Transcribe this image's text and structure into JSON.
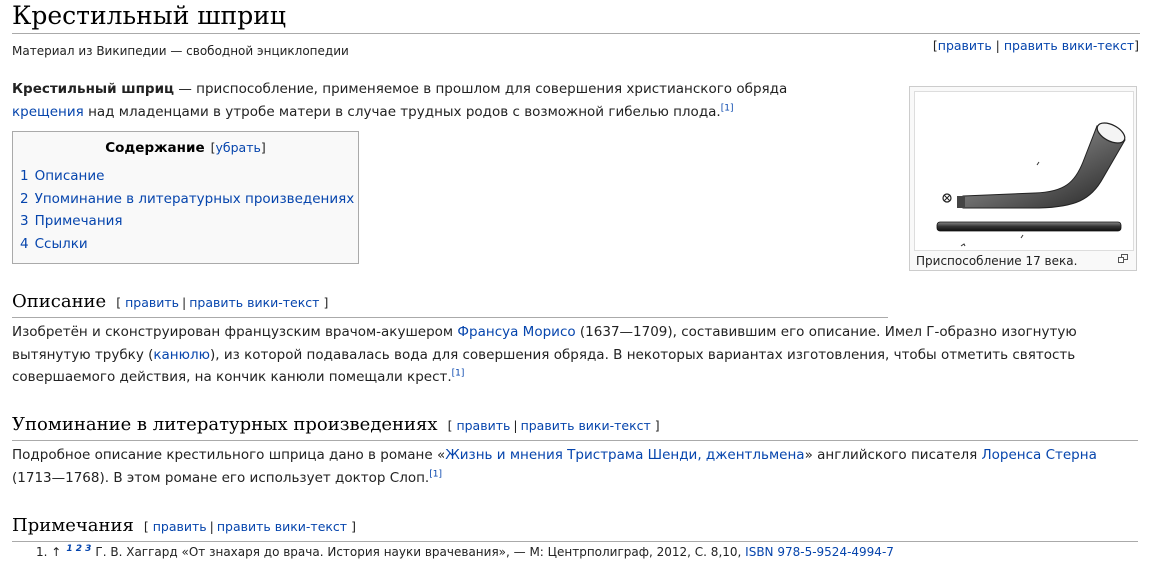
{
  "article": {
    "title": "Крестильный шприц",
    "site_sub": "Материал из Википедии — свободной энциклопедии",
    "edit_label": "править",
    "edit_wiki_label": "править вики-текст",
    "sep": "|",
    "lb": "[",
    "rb": "]"
  },
  "intro": {
    "bold": "Крестильный шприц",
    "t1": " — приспособление, применяемое в прошлом для совершения христианского обряда ",
    "link_baptism": "крещения",
    "t2": " над младенцами в утробе матери в случае трудных родов с возможной гибелью плода.",
    "ref": "[1]"
  },
  "toc": {
    "title": "Содержание",
    "hide": "[убрать]",
    "items": [
      {
        "num": "1",
        "label": "Описание"
      },
      {
        "num": "2",
        "label": "Упоминание в литературных произведениях"
      },
      {
        "num": "3",
        "label": "Примечания"
      },
      {
        "num": "4",
        "label": "Ссылки"
      }
    ]
  },
  "thumb": {
    "caption": "Приспособление 17 века."
  },
  "sections": {
    "description": {
      "heading": "Описание",
      "t1": "Изобретён и сконструирован французским врачом-акушером ",
      "link_person": "Франсуа Морисо",
      "t2": " (1637—1709), составившим его описание. Имел Г-образно изогнутую вытянутую трубку (",
      "link_cannula": "канюлю",
      "t3": "), из которой подавалась вода для совершения обряда. В некоторых вариантах изготовления, чтобы отметить святость совершаемого действия, на кончик канюли помещали крест.",
      "ref": "[1]"
    },
    "literature": {
      "heading": "Упоминание в литературных произведениях",
      "t1": "Подробное описание крестильного шприца дано в романе «",
      "link_novel": "Жизнь и мнения Тристрама Шенди, джентльмена",
      "t2": "» английского писателя ",
      "link_author": "Лоренса Стерна",
      "t3": " (1713—1768). В этом романе его использует доктор Слоп.",
      "ref": "[1]"
    },
    "notes": {
      "heading": "Примечания",
      "items": [
        {
          "num": "1.",
          "arrow": "↑",
          "backs": [
            "1",
            "2",
            "3"
          ],
          "text": "Г. В. Хаггард «От знахаря до врача. История науки врачевания», — М: Центрполиграф, 2012, С. 8,10, ",
          "isbn": "ISBN 978-5-9524-4994-7"
        }
      ]
    }
  }
}
